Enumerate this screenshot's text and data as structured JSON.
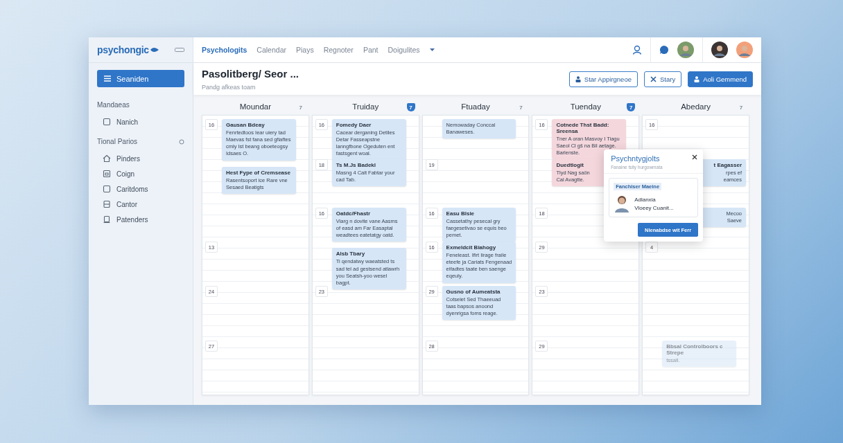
{
  "brand": {
    "name": "psychongic"
  },
  "nav": [
    {
      "label": "Psychologits",
      "selected": true
    },
    {
      "label": "Calendar",
      "selected": false
    },
    {
      "label": "Piays",
      "selected": false
    },
    {
      "label": "Regnoter",
      "selected": false
    },
    {
      "label": "Pant",
      "selected": false
    },
    {
      "label": "Doigulites",
      "selected": false
    }
  ],
  "sidebar": {
    "primary_button": "Seaniden",
    "sections": [
      {
        "heading": "Mandaeas",
        "items": [
          {
            "label": "Nanich",
            "kind": "square"
          }
        ]
      },
      {
        "heading": "Tional Parios",
        "items": [
          {
            "label": "Pinders",
            "kind": "home"
          },
          {
            "label": "Coign",
            "kind": "frame"
          },
          {
            "label": "Caritdoms",
            "kind": "square"
          },
          {
            "label": "Cantor",
            "kind": "split"
          },
          {
            "label": "Patenders",
            "kind": "stack"
          }
        ]
      }
    ]
  },
  "header": {
    "title": "Pasolitberg/ Seor ...",
    "subtitle": "Pandg afkeas toam",
    "buttons": [
      {
        "label": "Star Appirgneoe",
        "kind": "outline"
      },
      {
        "label": "Stary",
        "kind": "outline"
      },
      {
        "label": "Aoli Gemmend",
        "kind": "primary"
      }
    ]
  },
  "columns": [
    {
      "day": "Moundar",
      "badge": "7",
      "highlighted": false,
      "cells": [
        {
          "date": "16",
          "events": [
            {
              "title": "Gausan Bdeay",
              "body": "Fenrtedtoos Iear uiery tad Maevas fst fana sed gfiaftes cmly Ist beang oboeteogsy Idsaes O.",
              "color": "#d6e6f7",
              "kind": "full",
              "faded": false
            },
            {
              "title": "Hest Fype of Cremsease",
              "body": "Rasentsoport ice Rare vne Sesaed Beatigts",
              "color": "#d6e6f7",
              "kind": "full",
              "faded": false
            }
          ]
        },
        {},
        {},
        {
          "date": "13"
        },
        {
          "date": "24"
        },
        {
          "date": "27"
        }
      ]
    },
    {
      "day": "Truiday",
      "badge": "7",
      "highlighted": true,
      "cells": [
        {
          "date": "16",
          "events": [
            {
              "title": "Fomedy Daer",
              "body": "Cacear derganing Detiles Detar Fasseapstne lanngfbone Ogeduten ent fastsgent woal.",
              "color": "#d6e6f7",
              "kind": "full",
              "faded": false
            }
          ]
        },
        {
          "date": "18",
          "events": [
            {
              "title": "Ts M.Js Badekl",
              "body": "Masng 4 Calt Fabtar your cad Tab.",
              "color": "#d6e6f7",
              "kind": "full",
              "faded": false
            }
          ]
        },
        {
          "date": "16",
          "events": [
            {
              "title": "Oatdc/Fhastr",
              "body": "Viarg n dovite vane Aasms of easd am Far Easaptal weadtees eatetatgy oatd.",
              "color": "#d6e6f7",
              "kind": "full",
              "faded": false
            },
            {
              "title": "Alsb Tbary",
              "body": "Ti qendatwy waeatsted ts sad tel ad gestsend atlawrh you Seatsh-yoo wesel bagpt.",
              "color": "#d6e6f7",
              "kind": "full",
              "faded": false
            }
          ]
        },
        {},
        {
          "date": "23"
        },
        {}
      ]
    },
    {
      "day": "Ftuaday",
      "badge": "7",
      "highlighted": false,
      "cells": [
        {
          "events": [
            {
              "body": "Nemowaday Conccal Banaweses.",
              "color": "#d6e6f7",
              "kind": "full",
              "faded": false
            }
          ]
        },
        {
          "date": "19"
        },
        {
          "date": "16",
          "events": [
            {
              "title": "Easu Blsie",
              "body": "Cassetathy pesecal gry faegesetivao se equis beo pemet.",
              "color": "#d6e6f7",
              "kind": "full",
              "faded": false
            }
          ]
        },
        {
          "date": "16",
          "events": [
            {
              "title": "Exmeldcit Biahogy",
              "body": "Feneleast. Ifirt Iirage fraile eteefe ja Cariats Fengenaad eifadtes taate ben saenge eqeuly.",
              "color": "#d6e6f7",
              "kind": "full",
              "faded": false
            }
          ]
        },
        {
          "date": "29",
          "events": [
            {
              "title": "Gusno of Aumeatsta",
              "body": "Cotseiet Sed Thaeeuad taas bapsos anoond dyenrigsa foms reage.",
              "color": "#d6e6f7",
              "kind": "full",
              "faded": false
            }
          ]
        },
        {
          "date": "28"
        }
      ]
    },
    {
      "day": "Tuenday",
      "badge": "7",
      "highlighted": true,
      "cells": [
        {
          "date": "16",
          "events": [
            {
              "title": "Cotnede Thst Badd: Sreensa",
              "body": "Tner A oran Masvoy I Tiagu Saeol Cl gŝ na Bil aetage. Barlenste.",
              "color": "#f4d7dd",
              "kind": "full",
              "faded": false
            }
          ]
        },
        {
          "events": [
            {
              "title": "Duedtlogit",
              "body": "Tlyd Nag saön Cal Avagtte.",
              "color": "#f4d7dd",
              "kind": "covered-right",
              "faded": false
            }
          ]
        },
        {
          "date": "18"
        },
        {
          "date": "29"
        },
        {
          "date": "23"
        },
        {
          "date": "29"
        }
      ]
    },
    {
      "day": "Abedary",
      "badge": "7",
      "highlighted": false,
      "cells": [
        {
          "date": "16"
        },
        {
          "events": [
            {
              "title": "t Eagasser",
              "body": "rpes ef eamces",
              "color": "#d6e6f7",
              "kind": "covered-left",
              "faded": false
            }
          ]
        },
        {
          "events": [
            {
              "body": "Mecoo Saeve",
              "color": "#d6e6f7",
              "kind": "covered-left",
              "faded": false
            }
          ]
        },
        {
          "date": "4"
        },
        {},
        {
          "events": [
            {
              "title": "Bbsal Controlboors c Strepe",
              "body": "tssall.",
              "color": "#d6e6f7",
              "kind": "full",
              "faded": true
            }
          ]
        }
      ]
    }
  ],
  "popup": {
    "title": "Psychntygjolts",
    "subtitle": "Fanaine tsity hurgowmata",
    "tag": "Fanchiser Maeine",
    "person_name": "Adlanxia",
    "person_detail": "Vloeey Cuanit...",
    "button": "Nlenabdse wit Ferr"
  }
}
